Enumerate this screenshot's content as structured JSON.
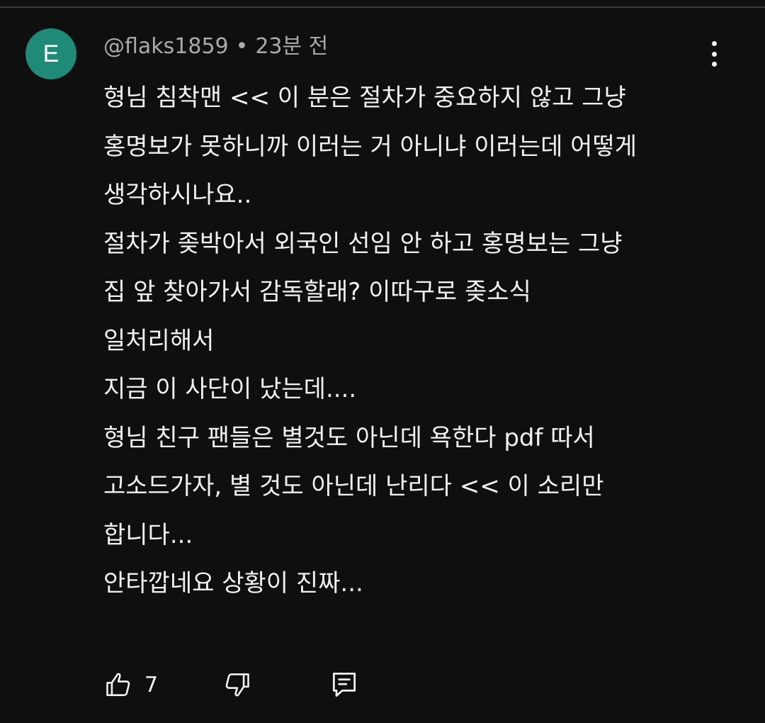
{
  "comment": {
    "avatar_letter": "E",
    "avatar_color": "#1f8a78",
    "author": "@flaks1859",
    "separator": "•",
    "time": "23분 전",
    "lines": [
      "형님 침착맨 << 이 분은 절차가 중요하지 않고 그냥",
      "홍명보가 못하니까 이러는 거 아니냐 이러는데 어떻게",
      "생각하시나요..",
      "절차가 좆박아서 외국인 선임 안 하고 홍명보는 그냥",
      "집 앞 찾아가서 감독할래? 이따구로 좆소식",
      "일처리해서",
      "지금 이 사단이 났는데....",
      "형님 친구 팬들은 별것도 아닌데 욕한다 pdf 따서",
      "고소드가자, 별 것도 아닌데 난리다 << 이 소리만",
      "합니다...",
      "안타깝네요 상황이 진짜..."
    ],
    "like_count": "7"
  },
  "icons": {
    "more": "more-vert-icon",
    "like": "thumbs-up-icon",
    "dislike": "thumbs-down-icon",
    "reply": "comment-reply-icon"
  },
  "colors": {
    "background": "#0f0f0f",
    "text": "#f1f1f1",
    "secondary_text": "#aaaaaa"
  }
}
